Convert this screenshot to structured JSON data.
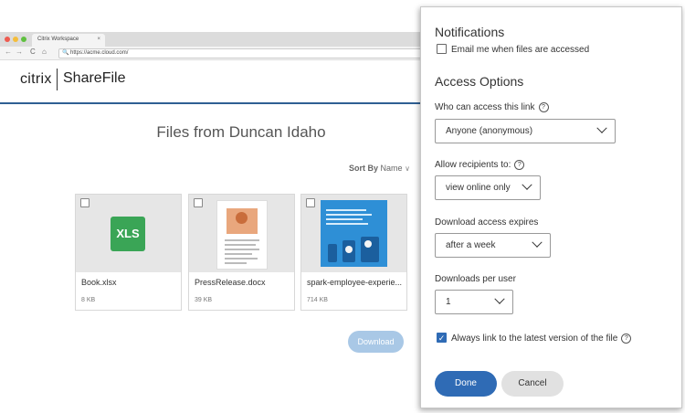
{
  "browser": {
    "tab_title": "Citrix Workspace",
    "tab_close": "×",
    "url": "https://acme.cloud.com/",
    "back": "←",
    "forward": "→",
    "reload": "C",
    "home": "⌂",
    "lock": "🔍"
  },
  "header": {
    "citrix_logo": "citrix",
    "product_logo": "ShareFile"
  },
  "main": {
    "title": "Files from Duncan Idaho",
    "sort_prefix": "Sort By",
    "sort_value": "Name",
    "sort_chevron": "∨",
    "files": [
      {
        "name": "Book.xlsx",
        "size": "8 KB",
        "thumb_label": "XLS"
      },
      {
        "name": "PressRelease.docx",
        "size": "39 KB"
      },
      {
        "name": "spark-employee-experie...",
        "size": "714 KB"
      }
    ],
    "download_label": "Download"
  },
  "panel": {
    "notifications_heading": "Notifications",
    "email_label": "Email me when files are accessed",
    "email_checked": false,
    "access_heading": "Access Options",
    "who_label": "Who can access this link",
    "who_value": "Anyone (anonymous)",
    "allow_label": "Allow recipients to:",
    "allow_value": "view online only",
    "expires_label": "Download access expires",
    "expires_value": "after a week",
    "downloads_label": "Downloads per user",
    "downloads_value": "1",
    "latest_label": "Always link to the latest version of the file",
    "latest_checked": true,
    "help_glyph": "?",
    "check_glyph": "✓",
    "done_label": "Done",
    "cancel_label": "Cancel"
  },
  "colors": {
    "accent": "#2f6bb5",
    "download_disabled": "#a9c8e6",
    "header_rule": "#2f5f93",
    "xls_green": "#3aa556"
  }
}
